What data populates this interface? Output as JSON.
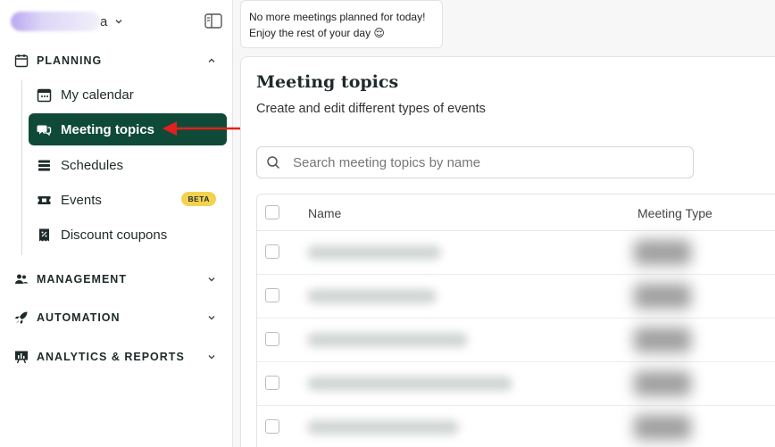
{
  "account": {
    "name_suffix": "a"
  },
  "sidebar": {
    "sections": {
      "planning": "PLANNING",
      "management": "MANAGEMENT",
      "automation": "AUTOMATION",
      "analytics": "ANALYTICS & REPORTS"
    },
    "items": [
      {
        "label": "My calendar",
        "icon": "calendar-icon"
      },
      {
        "label": "Meeting topics",
        "icon": "chat-bubbles-icon",
        "active": true
      },
      {
        "label": "Schedules",
        "icon": "stack-icon"
      },
      {
        "label": "Events",
        "icon": "ticket-icon",
        "badge": "BETA"
      },
      {
        "label": "Discount coupons",
        "icon": "coupon-icon"
      }
    ]
  },
  "toast": {
    "line1": "No more meetings planned for today!",
    "line2": "Enjoy the rest of your day 😌"
  },
  "main": {
    "title": "Meeting topics",
    "subtitle": "Create and edit different types of events",
    "search": {
      "placeholder": "Search meeting topics by name"
    },
    "table": {
      "columns": [
        "Name",
        "Meeting Type"
      ],
      "rows": 5
    }
  },
  "colors": {
    "accent": "#0e4a37",
    "badge": "#f3d24f",
    "annotation": "#e02020"
  }
}
